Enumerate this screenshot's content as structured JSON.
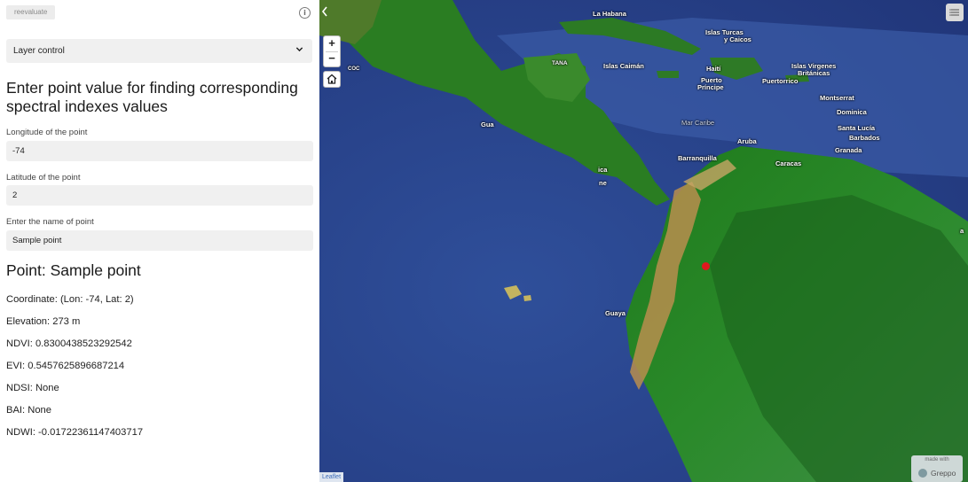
{
  "panel": {
    "reevaluate_label": "reevaluate",
    "info_glyph": "i",
    "layer_control_label": "Layer control",
    "heading": "Enter point value for finding corresponding spectral indexes values",
    "fields": {
      "longitude": {
        "label": "Longitude of the point",
        "value": "-74"
      },
      "latitude": {
        "label": "Latitude of the point",
        "value": "2"
      },
      "name": {
        "label": "Enter the name of point",
        "value": "Sample point"
      }
    },
    "point_title": "Point: Sample point",
    "results": {
      "coordinate": "Coordinate: (Lon: -74, Lat: 2)",
      "elevation": "Elevation: 273 m",
      "ndvi": "NDVI: 0.8300438523292542",
      "evi": "EVI: 0.5457625896687214",
      "ndsi": "NDSI: None",
      "bai": "BAI: None",
      "ndwi": "NDWI: -0.01722361147403717"
    }
  },
  "map": {
    "zoom_in": "+",
    "zoom_out": "−",
    "attribution": "Leaflet",
    "made_with": "made with",
    "brand": "Greppo",
    "labels": {
      "la_habana": "La Habana",
      "islas_turcas": "Islas Turcas",
      "y_caicos": "y Caicos",
      "islas_caiman": "Islas Caimán",
      "haiti": "Haití",
      "puerto": "Puerto",
      "principe": "Príncipe",
      "puerto_rico": "Puertorrico",
      "islas_virgenes": "Islas Virgenes",
      "britanicas": "Británicas",
      "montserrat": "Montserrat",
      "dominica": "Dominica",
      "santa_lucia": "Santa Lucía",
      "barbados": "Barbados",
      "granada": "Granada",
      "mar_caribe": "Mar Caribe",
      "aruba": "Aruba",
      "barranquilla": "Barranquilla",
      "caracas": "Caracas",
      "guayaquil": "Guaya",
      "gua": "Gua",
      "coc": "COC",
      "tana": "TANA",
      "ica": "ica",
      "ne": "ne",
      "a_edge": "a"
    },
    "colors": {
      "ocean_deep": "#24397f",
      "ocean": "#2f4f9a",
      "shelf": "#6d8fc9",
      "forest": "#1d6b1d",
      "forest_dark": "#0f4f12",
      "highland": "#c9a15a",
      "pin": "#e0181e"
    }
  }
}
